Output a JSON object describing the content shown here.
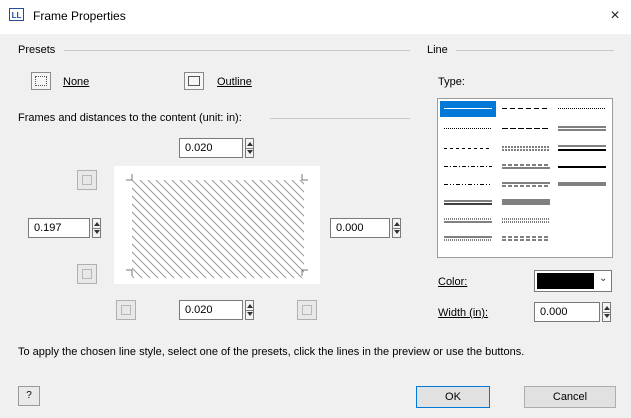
{
  "window": {
    "icon": "LL",
    "title": "Frame Properties",
    "close": "×"
  },
  "presets": {
    "label": "Presets",
    "none_label": "None",
    "outline_label": "Outline"
  },
  "frames": {
    "label": "Frames and distances to the content (unit: in):",
    "top": "0.020",
    "left": "0.197",
    "right": "0.000",
    "bottom": "0.020"
  },
  "line": {
    "label": "Line",
    "type_label": "Type:",
    "color_label": "Color:",
    "color_value": "#000000",
    "width_label": "Width (in):",
    "width_value": "0.000"
  },
  "hint": "To apply the chosen line style, select one of the presets, click the lines in the preview or use the buttons.",
  "buttons": {
    "ok": "OK",
    "cancel": "Cancel",
    "help": "?"
  }
}
